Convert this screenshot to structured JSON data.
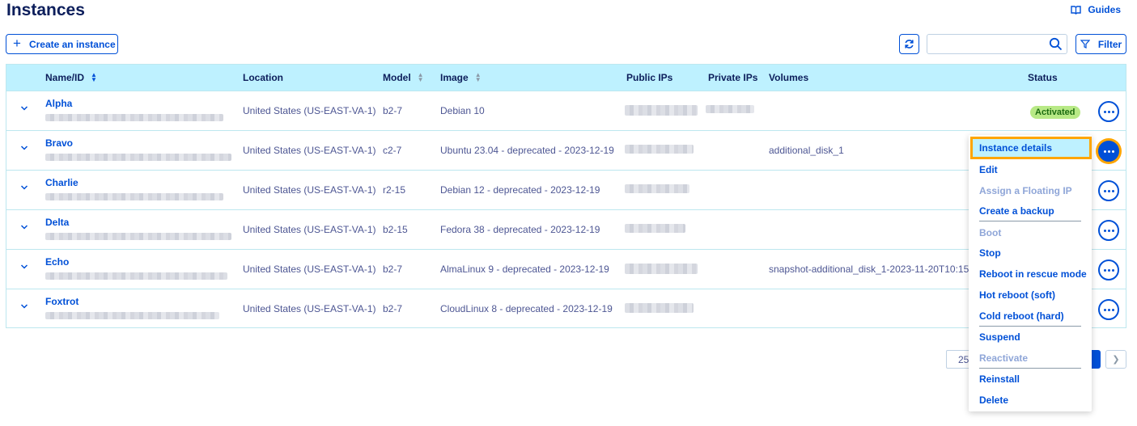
{
  "header": {
    "title": "Instances",
    "guides_label": "Guides"
  },
  "toolbar": {
    "create_label": "Create an instance",
    "search_placeholder": "",
    "filter_label": "Filter"
  },
  "table": {
    "columns": [
      "Name/ID",
      "Location",
      "Model",
      "Image",
      "Public IPs",
      "Private IPs",
      "Volumes",
      "Status"
    ],
    "rows": [
      {
        "name": "Alpha",
        "location": "United States (US-EAST-VA-1)",
        "model": "b2-7",
        "image": "Debian 10",
        "volumes": "",
        "status": "Activated"
      },
      {
        "name": "Bravo",
        "location": "United States (US-EAST-VA-1)",
        "model": "c2-7",
        "image": "Ubuntu 23.04 - deprecated - 2023-12-19",
        "volumes": "additional_disk_1",
        "status": ""
      },
      {
        "name": "Charlie",
        "location": "United States (US-EAST-VA-1)",
        "model": "r2-15",
        "image": "Debian 12 - deprecated - 2023-12-19",
        "volumes": "",
        "status": ""
      },
      {
        "name": "Delta",
        "location": "United States (US-EAST-VA-1)",
        "model": "b2-15",
        "image": "Fedora 38 - deprecated - 2023-12-19",
        "volumes": "",
        "status": ""
      },
      {
        "name": "Echo",
        "location": "United States (US-EAST-VA-1)",
        "model": "b2-7",
        "image": "AlmaLinux 9 - deprecated - 2023-12-19",
        "volumes": "snapshot-additional_disk_1-2023-11-20T10:15",
        "status": ""
      },
      {
        "name": "Foxtrot",
        "location": "United States (US-EAST-VA-1)",
        "model": "b2-7",
        "image": "CloudLinux 8 - deprecated - 2023-12-19",
        "volumes": "",
        "status": ""
      }
    ]
  },
  "pagination": {
    "page_size": "25"
  },
  "action_menu": {
    "items": [
      {
        "label": "Instance details",
        "state": "highlighted"
      },
      {
        "label": "Edit",
        "state": "enabled"
      },
      {
        "label": "Assign a Floating IP",
        "state": "disabled"
      },
      {
        "label": "Create a backup",
        "state": "enabled"
      },
      {
        "label": "Boot",
        "state": "disabled"
      },
      {
        "label": "Stop",
        "state": "enabled"
      },
      {
        "label": "Reboot in rescue mode",
        "state": "enabled"
      },
      {
        "label": "Hot reboot (soft)",
        "state": "enabled"
      },
      {
        "label": "Cold reboot (hard)",
        "state": "enabled"
      },
      {
        "label": "Suspend",
        "state": "enabled"
      },
      {
        "label": "Reactivate",
        "state": "disabled"
      },
      {
        "label": "Reinstall",
        "state": "enabled"
      },
      {
        "label": "Delete",
        "state": "enabled"
      }
    ]
  },
  "colors": {
    "primary": "#0050d7",
    "header_bg": "#bef1ff",
    "title": "#0c1e5b",
    "text": "#4d5693",
    "badge_bg": "#b8e986",
    "highlight_border": "#ffa500"
  },
  "icons": [
    "book-icon",
    "plus-icon",
    "refresh-icon",
    "search-icon",
    "filter-icon",
    "sort-icon",
    "chevron-down-icon",
    "more-options-icon",
    "chevron-right-icon"
  ]
}
